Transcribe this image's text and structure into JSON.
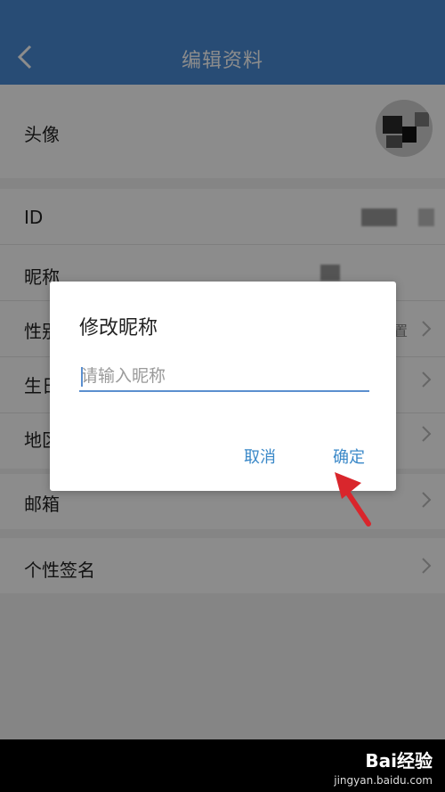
{
  "header": {
    "title": "编辑资料"
  },
  "rows": {
    "avatar": "头像",
    "id": "ID",
    "nickname": "昵称",
    "gender": "性别",
    "gender_value": "置",
    "birthday": "生日",
    "region": "地区",
    "email": "邮箱",
    "signature": "个性签名"
  },
  "dialog": {
    "title": "修改昵称",
    "input_placeholder": "请输入昵称",
    "cancel_label": "取消",
    "confirm_label": "确定"
  },
  "watermark": {
    "brand": "Bai经验",
    "sub": "jingyan.baidu.com"
  },
  "colors": {
    "header": "#4a8ad5",
    "accent": "#3a88c8",
    "arrow": "#d9262c"
  }
}
